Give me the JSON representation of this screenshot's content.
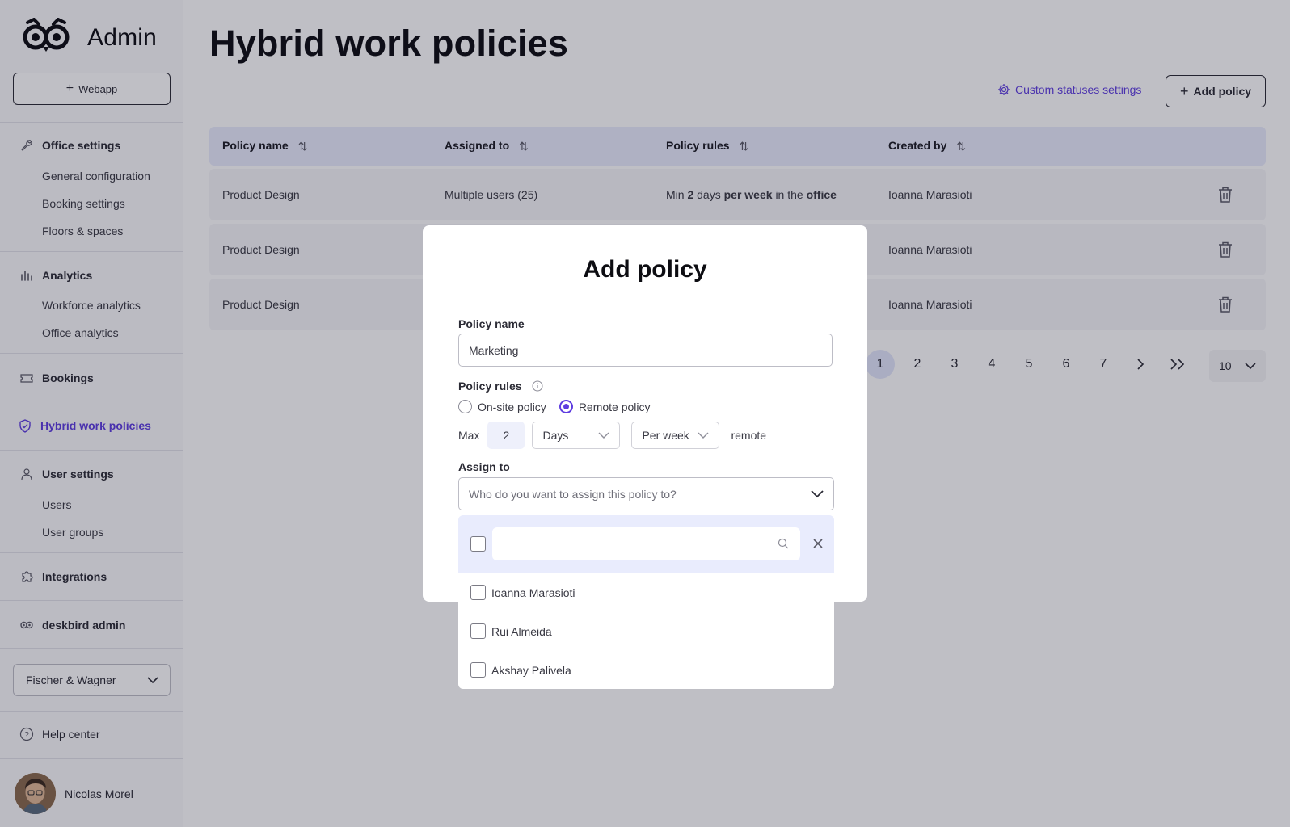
{
  "sidebar": {
    "app_title": "Admin",
    "webapp_label": "Webapp",
    "sections": {
      "office_settings": "Office settings",
      "general_configuration": "General configuration",
      "booking_settings": "Booking settings",
      "floors_spaces": "Floors & spaces",
      "analytics": "Analytics",
      "workforce_analytics": "Workforce analytics",
      "office_analytics": "Office analytics",
      "bookings": "Bookings",
      "hybrid_work_policies": "Hybrid work policies",
      "user_settings": "User settings",
      "users": "Users",
      "user_groups": "User groups",
      "integrations": "Integrations",
      "deskbird_admin": "deskbird admin"
    },
    "company": "Fischer & Wagner",
    "help": "Help center",
    "user_name": "Nicolas Morel"
  },
  "page": {
    "title": "Hybrid work policies",
    "custom_statuses": "Custom statuses settings",
    "add_policy": "Add policy"
  },
  "table": {
    "headers": [
      "Policy name",
      "Assigned to",
      "Policy rules",
      "Created by"
    ],
    "rows": [
      {
        "name": "Product Design",
        "assigned": "Multiple users (25)",
        "rule": {
          "min": "Min",
          "count": "2",
          "days": "days",
          "per_week": "per week",
          "in_the": "in the",
          "office": "office"
        },
        "created_by": "Ioanna Marasioti"
      },
      {
        "name": "Product Design",
        "created_by": "Ioanna Marasioti"
      },
      {
        "name": "Product Design",
        "created_by": "Ioanna Marasioti"
      }
    ]
  },
  "pagination": {
    "pages": [
      "1",
      "2",
      "3",
      "4",
      "5",
      "6",
      "7"
    ],
    "current": "1",
    "per_page": "10"
  },
  "modal": {
    "title": "Add policy",
    "policy_name_label": "Policy name",
    "policy_name_value": "Marketing",
    "policy_rules_label": "Policy rules",
    "onsite_label": "On-site policy",
    "remote_label": "Remote policy",
    "selected_policy": "Remote policy",
    "max_label": "Max",
    "max_value": "2",
    "unit_value": "Days",
    "period_value": "Per week",
    "remote_suffix": "remote",
    "assign_label": "Assign to",
    "assign_placeholder": "Who do you want to assign this policy to?"
  },
  "dropdown": {
    "search_value": "",
    "users": [
      "Ioanna Marasioti",
      "Rui Almeida",
      "Akshay Palivela"
    ]
  },
  "colors": {
    "accent": "#5e3de0",
    "header_bg": "#e9ecfd",
    "overlay": "rgba(20,20,40,0.27)"
  }
}
